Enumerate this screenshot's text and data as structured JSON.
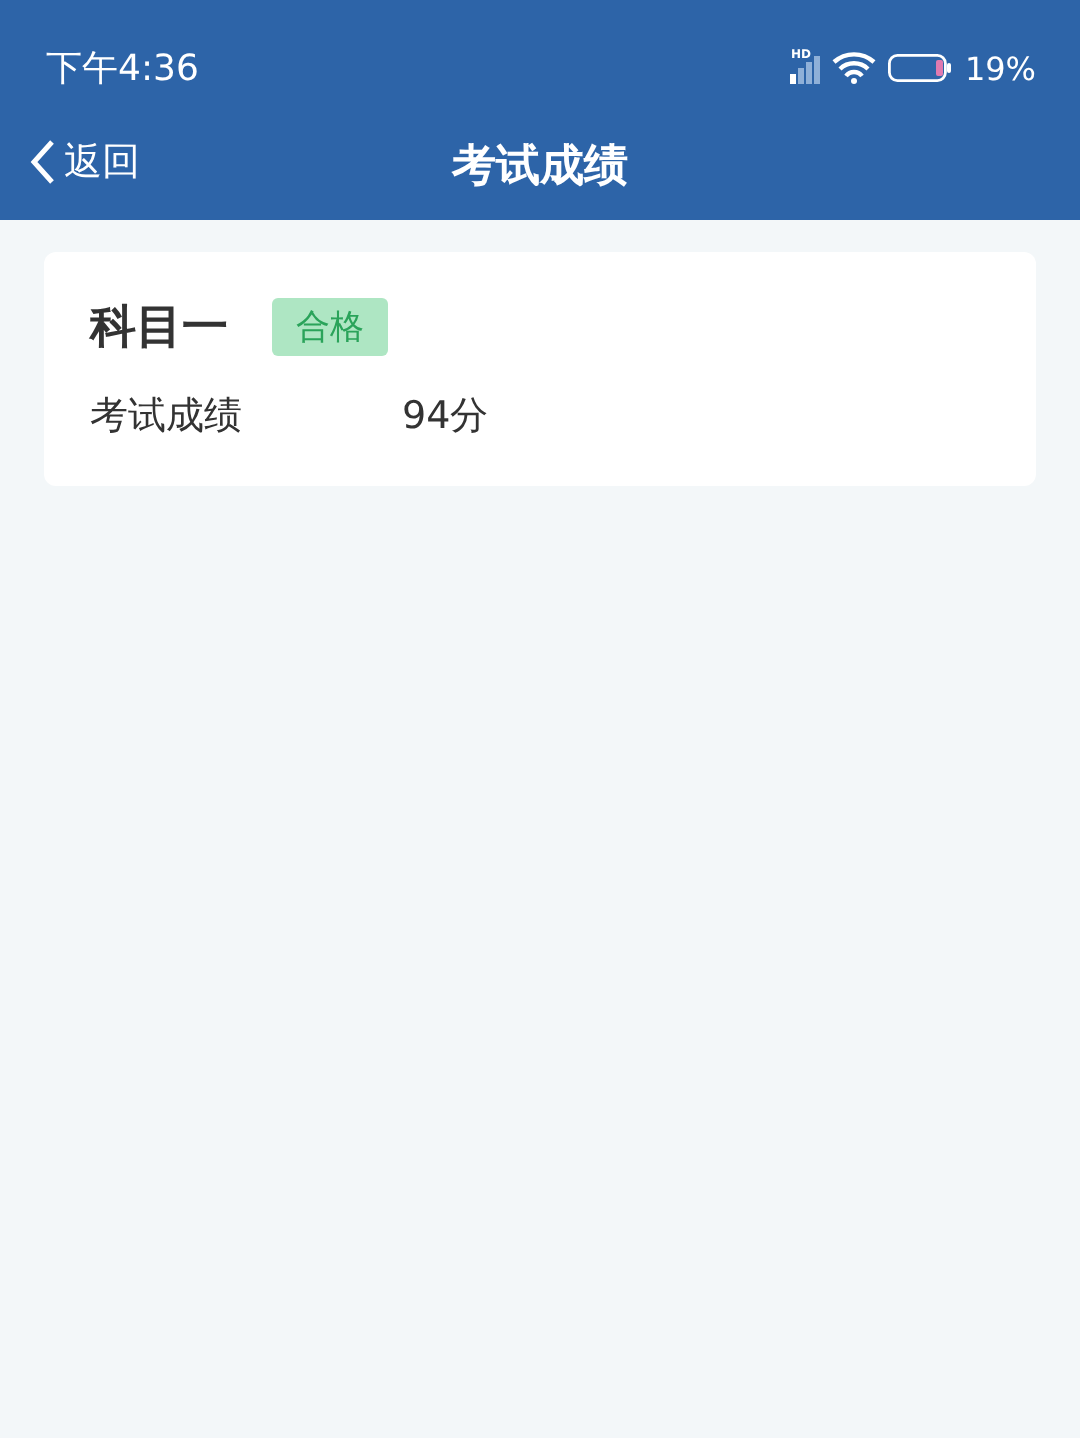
{
  "status_bar": {
    "time": "下午4:36",
    "network": "HD",
    "battery": "19%"
  },
  "nav": {
    "back": "返回",
    "title": "考试成绩"
  },
  "results": [
    {
      "subject": "科目一",
      "badge": {
        "label": "合格",
        "kind": "pass"
      },
      "score_label": "考试成绩",
      "score": "94分"
    }
  ]
}
